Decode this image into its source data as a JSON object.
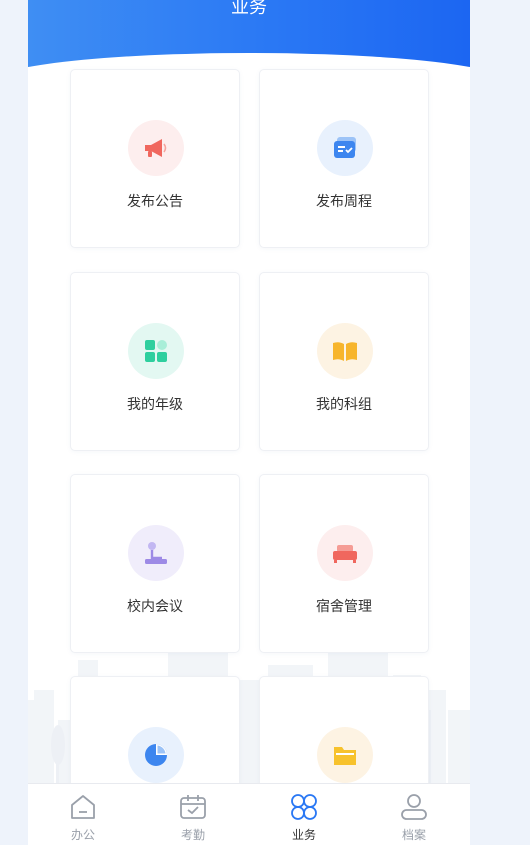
{
  "header": {
    "title": "业务"
  },
  "cards": [
    {
      "label": "发布公告",
      "icon": "megaphone-icon",
      "bg": "#fdeeee",
      "color": "#f0675e"
    },
    {
      "label": "发布周程",
      "icon": "schedule-card-icon",
      "bg": "#e8f1fd",
      "color": "#3d86ef"
    },
    {
      "label": "我的年级",
      "icon": "grade-grid-icon",
      "bg": "#e3f8f2",
      "color": "#2ecf9e"
    },
    {
      "label": "我的科组",
      "icon": "book-icon",
      "bg": "#fdf3e3",
      "color": "#f7b52c"
    },
    {
      "label": "校内会议",
      "icon": "meeting-mic-icon",
      "bg": "#f0edfb",
      "color": "#9d8ae6"
    },
    {
      "label": "宿舍管理",
      "icon": "bed-icon",
      "bg": "#fdeeee",
      "color": "#f0675e"
    },
    {
      "label": "",
      "icon": "pie-chart-icon",
      "bg": "#e8f1fd",
      "color": "#3d86ef"
    },
    {
      "label": "",
      "icon": "folder-icon",
      "bg": "#fdf3e3",
      "color": "#f7c22c"
    }
  ],
  "tabbar": {
    "items": [
      {
        "label": "办公",
        "icon": "home-icon"
      },
      {
        "label": "考勤",
        "icon": "calendar-check-icon"
      },
      {
        "label": "业务",
        "icon": "four-circles-icon",
        "active": true
      },
      {
        "label": "档案",
        "icon": "user-profile-icon"
      }
    ]
  },
  "colors": {
    "header_start": "#3f8ef3",
    "header_end": "#1c66f2",
    "active_tab": "#2a78f4",
    "inactive_tab": "#9aa0aa"
  }
}
